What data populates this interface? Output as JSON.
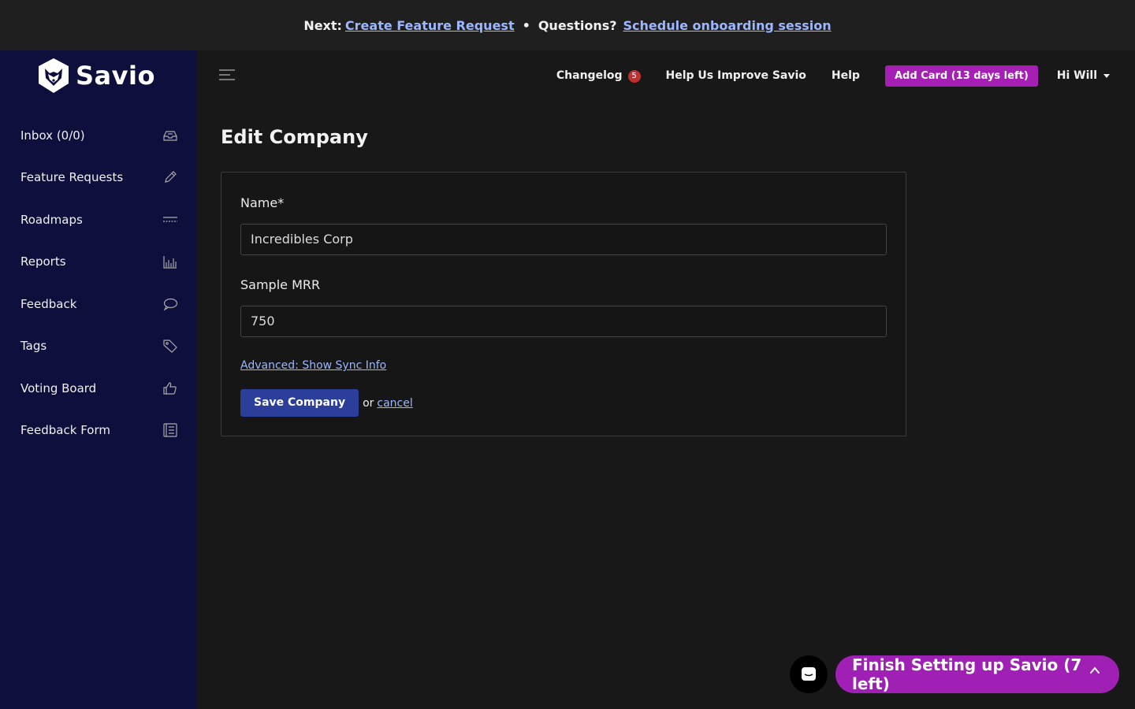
{
  "topbar": {
    "next_label": "Next:",
    "next_link": "Create Feature Request",
    "separator": "•",
    "questions_label": "Questions?",
    "questions_link": "Schedule onboarding session"
  },
  "brand": {
    "name": "Savio"
  },
  "sidebar": {
    "items": [
      {
        "label": "Inbox (0/0)",
        "icon": "inbox-icon"
      },
      {
        "label": "Feature Requests",
        "icon": "pencil-icon"
      },
      {
        "label": "Roadmaps",
        "icon": "roadmap-icon"
      },
      {
        "label": "Reports",
        "icon": "bar-chart-icon"
      },
      {
        "label": "Feedback",
        "icon": "speech-bubble-icon"
      },
      {
        "label": "Tags",
        "icon": "tag-icon"
      },
      {
        "label": "Voting Board",
        "icon": "thumbs-up-icon"
      },
      {
        "label": "Feedback Form",
        "icon": "form-icon"
      }
    ]
  },
  "header": {
    "changelog": "Changelog",
    "changelog_count": "5",
    "improve": "Help Us Improve Savio",
    "help": "Help",
    "add_card": "Add Card (13 days left)",
    "user": "Hi Will"
  },
  "page": {
    "title": "Edit Company",
    "name_label": "Name*",
    "name_value": "Incredibles Corp",
    "mrr_label": "Sample MRR",
    "mrr_value": "750",
    "advanced_link": "Advanced: Show Sync Info",
    "save_label": "Save Company",
    "or_text": "or",
    "cancel_label": "cancel"
  },
  "footer": {
    "finish_label": "Finish Setting up Savio (7 left)"
  },
  "colors": {
    "sidebar_bg": "#0f0f3e",
    "accent_purple": "#a51fb4",
    "primary_button": "#2a3e9a",
    "link": "#9db7ff"
  }
}
